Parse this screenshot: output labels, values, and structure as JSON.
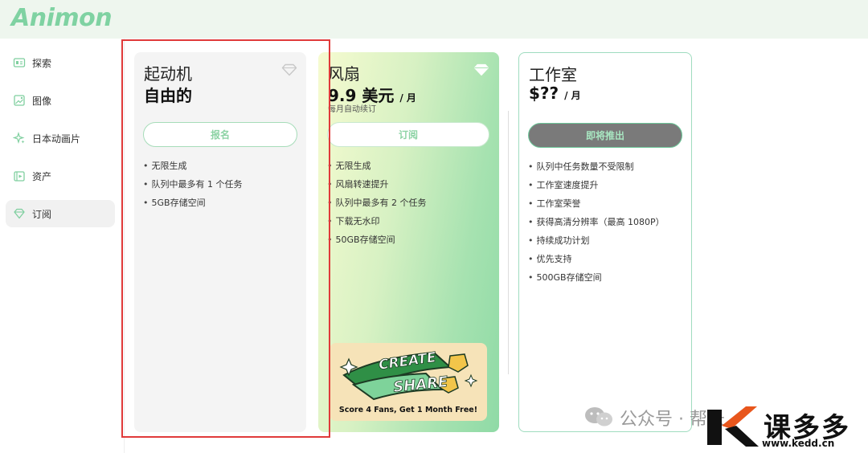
{
  "app": {
    "logo": "Animon",
    "brand_color": "#7fd2a2"
  },
  "sidebar": {
    "items": [
      {
        "label": "探索",
        "icon": "explore-icon",
        "active": false
      },
      {
        "label": "图像",
        "icon": "image-icon",
        "active": false
      },
      {
        "label": "日本动画片",
        "icon": "sparkle-icon",
        "active": false
      },
      {
        "label": "资产",
        "icon": "assets-icon",
        "active": false
      },
      {
        "label": "订阅",
        "icon": "diamond-icon",
        "active": true
      }
    ]
  },
  "plans": [
    {
      "name": "起动机",
      "price": "自由的",
      "unit": "",
      "note": "",
      "button": "报名",
      "icon": "diamond-outline-icon",
      "features": [
        "无限生成",
        "队列中最多有 1 个任务",
        "5GB存储空间"
      ]
    },
    {
      "name": "风扇",
      "price": "9.9 美元",
      "unit": "/ 月",
      "note": "每月自动续订",
      "button": "订阅",
      "icon": "diamond-filled-icon",
      "features": [
        "无限生成",
        "风扇转速提升",
        "队列中最多有 2 个任务",
        "下载无水印",
        "50GB存储空间"
      ],
      "promo": {
        "title": "CREATE & SHARE",
        "caption": "Score 4 Fans, Get 1 Month Free!"
      }
    },
    {
      "name": "工作室",
      "price": "$??",
      "unit": "/ 月",
      "note": "",
      "button": "即将推出",
      "icon": "",
      "features": [
        "队列中任务数量不受限制",
        "工作室速度提升",
        "工作室荣誉",
        "获得高清分辨率（最高 1080P）",
        "持续成功计划",
        "优先支持",
        "500GB存储空间"
      ]
    }
  ],
  "watermark": {
    "text": "公众号 · 帮长",
    "site": "课多多",
    "url": "www.kedd.cn"
  }
}
